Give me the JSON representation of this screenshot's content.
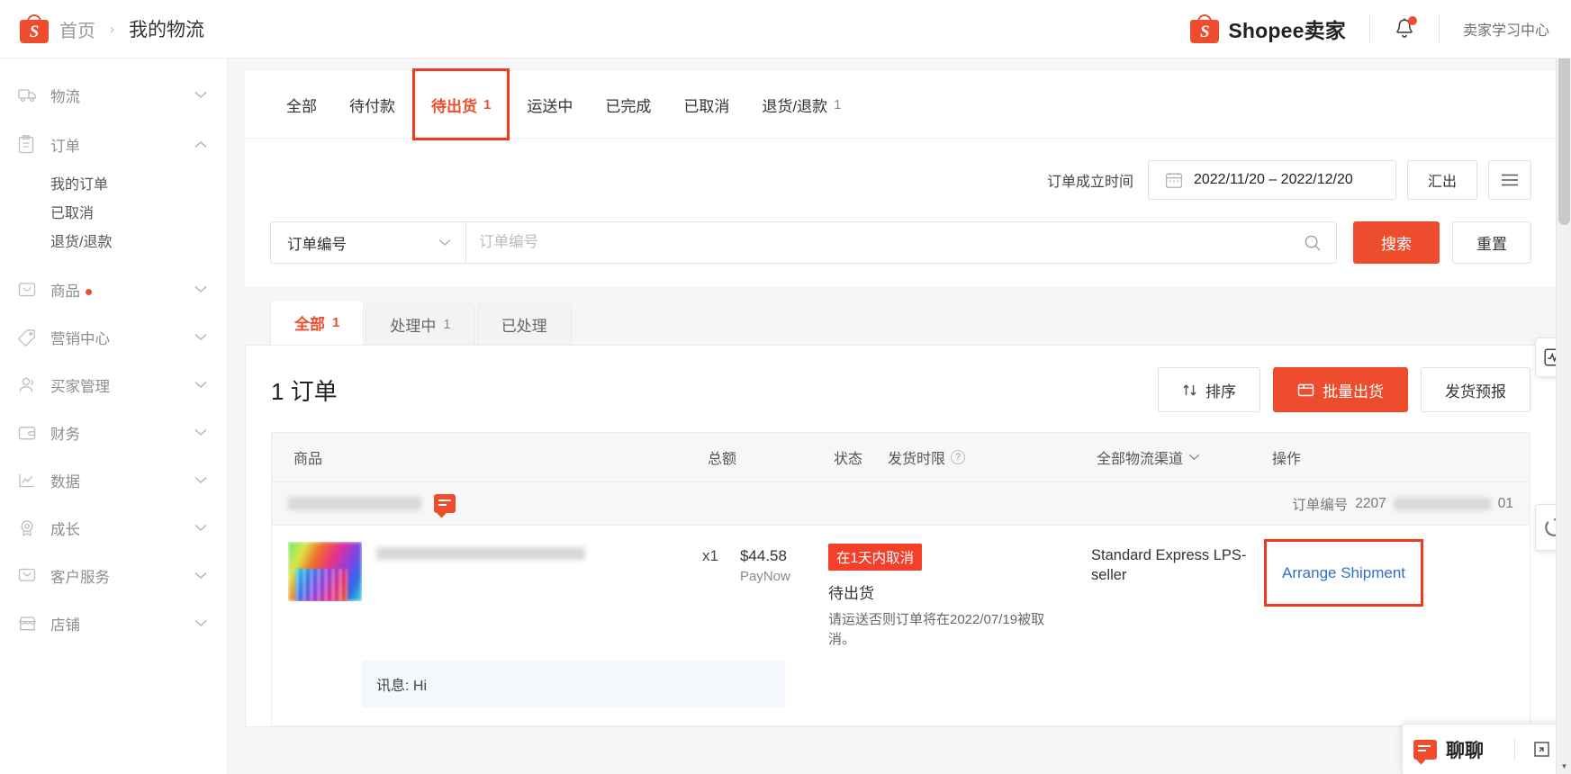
{
  "header": {
    "breadcrumb_home": "首页",
    "breadcrumb_sep": "›",
    "breadcrumb_current": "我的物流",
    "brand_name": "Shopee卖家",
    "brand_mark": "S",
    "learning_center": "卖家学习中心",
    "bell_icon": "bell-icon",
    "bell_has_badge": true
  },
  "sidebar": {
    "items": [
      {
        "label": "物流",
        "icon": "truck-icon",
        "expanded": false,
        "dot": false
      },
      {
        "label": "订单",
        "icon": "clipboard-icon",
        "expanded": true,
        "dot": false
      },
      {
        "label": "商品",
        "icon": "box-icon",
        "expanded": false,
        "dot": true
      },
      {
        "label": "营销中心",
        "icon": "tag-icon",
        "expanded": false,
        "dot": false
      },
      {
        "label": "买家管理",
        "icon": "user-icon",
        "expanded": false,
        "dot": false
      },
      {
        "label": "财务",
        "icon": "wallet-icon",
        "expanded": false,
        "dot": false
      },
      {
        "label": "数据",
        "icon": "chart-icon",
        "expanded": false,
        "dot": false
      },
      {
        "label": "成长",
        "icon": "medal-icon",
        "expanded": false,
        "dot": false
      },
      {
        "label": "客户服务",
        "icon": "chat-icon",
        "expanded": false,
        "dot": false
      },
      {
        "label": "店铺",
        "icon": "shop-icon",
        "expanded": false,
        "dot": false
      }
    ],
    "order_subitems": [
      "我的订单",
      "已取消",
      "退货/退款"
    ]
  },
  "tabs": [
    {
      "label": "全部",
      "count": "",
      "active": false,
      "highlight": false
    },
    {
      "label": "待付款",
      "count": "",
      "active": false,
      "highlight": false
    },
    {
      "label": "待出货",
      "count": "1",
      "active": true,
      "highlight": true
    },
    {
      "label": "运送中",
      "count": "",
      "active": false,
      "highlight": false
    },
    {
      "label": "已完成",
      "count": "",
      "active": false,
      "highlight": false
    },
    {
      "label": "已取消",
      "count": "",
      "active": false,
      "highlight": false
    },
    {
      "label": "退货/退款",
      "count": "1",
      "active": false,
      "highlight": false
    }
  ],
  "filters": {
    "date_label": "订单成立时间",
    "date_value": "2022/11/20 – 2022/12/20",
    "calendar_icon": "calendar-icon",
    "export_label": "汇出",
    "menu_icon": "hamburger-menu-icon",
    "select_value": "订单编号",
    "chevron_icon": "chevron-down-icon",
    "search_placeholder": "订单编号",
    "search_value": "",
    "search_icon": "search-icon",
    "search_button": "搜索",
    "reset_button": "重置"
  },
  "pills": [
    {
      "label": "全部",
      "count": "1",
      "active": true
    },
    {
      "label": "处理中",
      "count": "1",
      "active": false
    },
    {
      "label": "已处理",
      "count": "",
      "active": false
    }
  ],
  "list": {
    "order_count_text": "1 订单",
    "sort_button": "排序",
    "sort_icon": "sort-icon",
    "bulk_ship_button": "批量出货",
    "bulk_ship_icon": "ship-box-icon",
    "forecast_button": "发货预报"
  },
  "table": {
    "columns": {
      "product": "商品",
      "total": "总额",
      "status": "状态",
      "deadline": "发货时限",
      "deadline_help_icon": "question-mark-icon",
      "channel": "全部物流渠道",
      "channel_chevron": "chevron-down-icon",
      "action": "操作"
    }
  },
  "order": {
    "shop_name_redacted": true,
    "chat_icon": "chat-bubble-icon",
    "order_no_label": "订单编号",
    "order_no_prefix": "2207",
    "order_no_suffix": "01",
    "product_title_redacted": true,
    "quantity": "x1",
    "price": "$44.58",
    "pay_method": "PayNow",
    "cancel_badge": "在1天内取消",
    "status": "待出货",
    "status_note": "请运送否则订单将在2022/07/19被取消。",
    "channel": "Standard Express LPS-seller",
    "action_link": "Arrange Shipment",
    "message_label": "讯息:",
    "message_text": "Hi"
  },
  "widgets": {
    "analytics_icon": "analytics-pulse-icon",
    "circle_icon": "loading-circle-icon",
    "chat_dock_title": "聊聊",
    "chat_dock_icon": "chat-bubble-icon",
    "chat_dock_expand_icon": "expand-icon"
  },
  "colors": {
    "brand": "#ee4d2d",
    "highlight_outline": "#ee3a20",
    "link": "#2f6fd0",
    "badge_red": "#f4402a"
  }
}
